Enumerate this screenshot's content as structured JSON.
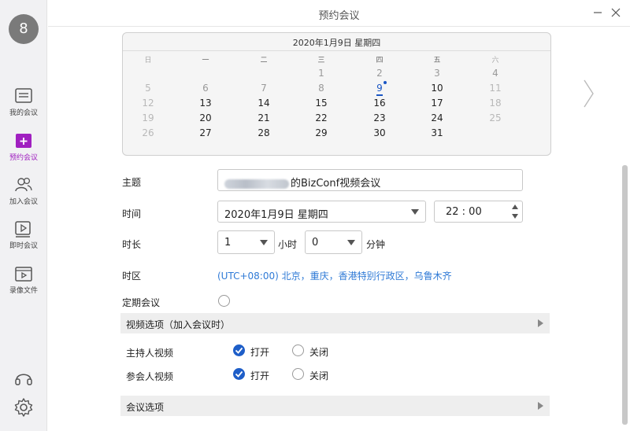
{
  "sidebar": {
    "avatar_text": "8",
    "items": [
      {
        "label": "我的会议",
        "icon": "list-icon"
      },
      {
        "label": "预约会议",
        "icon": "calendar-plus-icon"
      },
      {
        "label": "加入会议",
        "icon": "people-icon"
      },
      {
        "label": "即时会议",
        "icon": "video-play-icon"
      },
      {
        "label": "录像文件",
        "icon": "film-icon"
      }
    ],
    "active_color": "#a020c0"
  },
  "window": {
    "title": "预约会议"
  },
  "calendar": {
    "header": "2020年1月9日  星期四",
    "weekdays": [
      "日",
      "一",
      "二",
      "三",
      "四",
      "五",
      "六"
    ],
    "weeks": [
      [
        "",
        "",
        "",
        "1",
        "2",
        "3",
        "4"
      ],
      [
        "5",
        "6",
        "7",
        "8",
        "9",
        "10",
        "11"
      ],
      [
        "12",
        "13",
        "14",
        "15",
        "16",
        "17",
        "18"
      ],
      [
        "19",
        "20",
        "21",
        "22",
        "23",
        "24",
        "25"
      ],
      [
        "26",
        "27",
        "28",
        "29",
        "30",
        "31",
        ""
      ]
    ],
    "today": "9"
  },
  "form": {
    "topic_label": "主题",
    "topic_value": "的BizConf视频会议",
    "time_label": "时间",
    "date_value": "2020年1月9日  星期四",
    "time_value": "22 : 00",
    "duration_label": "时长",
    "hours_value": "1",
    "hours_unit": "小时",
    "minutes_value": "0",
    "minutes_unit": "分钟",
    "timezone_label": "时区",
    "timezone_value": "(UTC+08:00) 北京，重庆，香港特别行政区，乌鲁木齐",
    "recurring_label": "定期会议"
  },
  "video_section": {
    "title": "视频选项（加入会议时）",
    "host_label": "主持人视频",
    "participant_label": "参会人视频",
    "on_label": "打开",
    "off_label": "关闭",
    "host_on": true,
    "participant_on": true
  },
  "meeting_section": {
    "title": "会议选项"
  },
  "colors": {
    "accent": "#1e5ec8",
    "link": "#2f7ad6"
  }
}
